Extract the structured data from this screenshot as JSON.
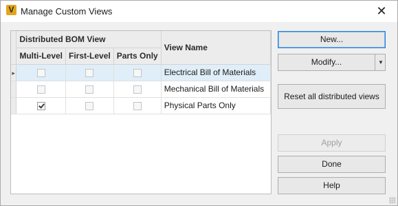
{
  "window": {
    "app_icon_letter": "V",
    "title": "Manage Custom Views",
    "close_glyph": "✕"
  },
  "grid": {
    "group_header": "Distributed BOM View",
    "columns": [
      "Multi-Level",
      "First-Level",
      "Parts Only"
    ],
    "name_header": "View Name",
    "row_indicator_glyph": "▸",
    "rows": [
      {
        "name": "Electrical Bill of Materials",
        "multi_level": false,
        "first_level": false,
        "parts_only": false,
        "selected": true
      },
      {
        "name": "Mechanical Bill of Materials",
        "multi_level": false,
        "first_level": false,
        "parts_only": false,
        "selected": false
      },
      {
        "name": "Physical Parts Only",
        "multi_level": true,
        "first_level": false,
        "parts_only": false,
        "selected": false
      }
    ]
  },
  "buttons": {
    "new": "New...",
    "modify": "Modify...",
    "reset": "Reset all distributed views",
    "apply": "Apply",
    "done": "Done",
    "help": "Help"
  },
  "colors": {
    "selected_row": "#dfeef8",
    "primary_focus": "#2d7fd6",
    "app_icon": "#e3a51c"
  }
}
